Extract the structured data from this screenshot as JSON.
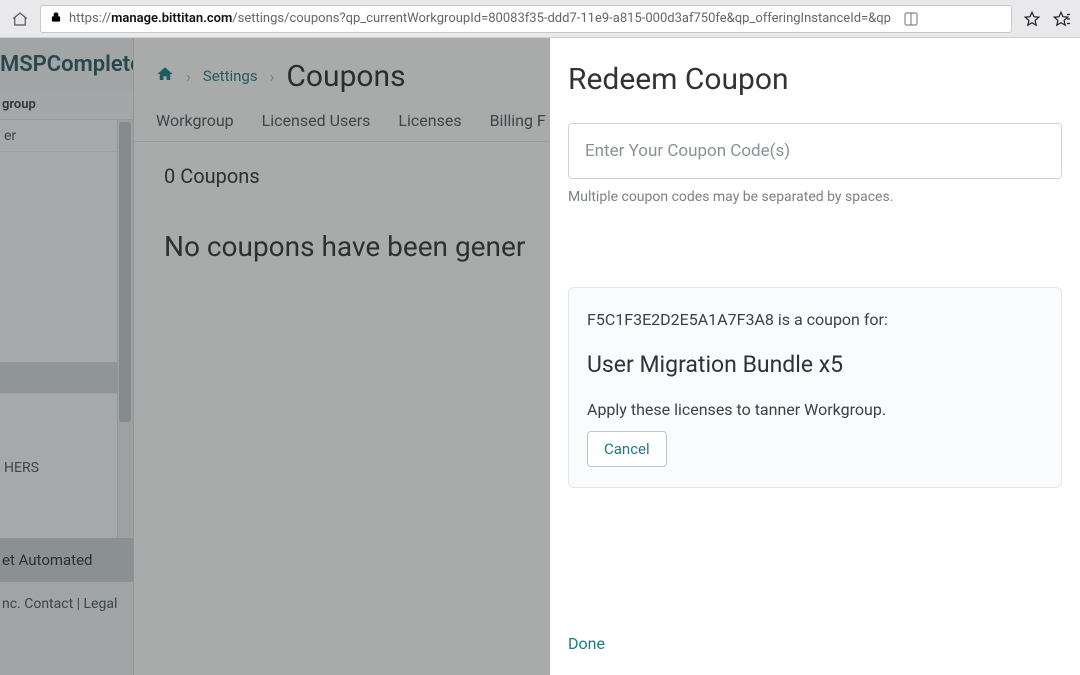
{
  "browser": {
    "url_proto": "https://",
    "url_bold": "manage.bittitan.com",
    "url_rest": "/settings/coupons?qp_currentWorkgroupId=80083f35-ddd7-11e9-a815-000d3af750fe&qp_offeringInstanceId=&qp"
  },
  "brand": "MSPComplete",
  "sidebar": {
    "group_label": "group",
    "items": [
      {
        "label": "er"
      },
      {
        "label": ""
      },
      {
        "label": ""
      },
      {
        "label": ""
      },
      {
        "label": "HERS"
      }
    ],
    "automated": "et Automated",
    "footer": "nc. Contact | Legal"
  },
  "breadcrumb": {
    "settings": "Settings",
    "title": "Coupons"
  },
  "tabs": {
    "t1": "Workgroup",
    "t2": "Licensed Users",
    "t3": "Licenses",
    "t4": "Billing F"
  },
  "list": {
    "count": "0 Coupons",
    "empty": "No coupons have been gener"
  },
  "panel": {
    "title": "Redeem Coupon",
    "placeholder": "Enter Your Coupon Code(s)",
    "hint": "Multiple coupon codes may be separated by spaces.",
    "card": {
      "code_line": "F5C1F3E2D2E5A1A7F3A8 is a coupon for:",
      "product": "User Migration Bundle x5",
      "apply_line": "Apply these licenses to tanner Workgroup.",
      "cancel": "Cancel"
    },
    "done": "Done"
  }
}
